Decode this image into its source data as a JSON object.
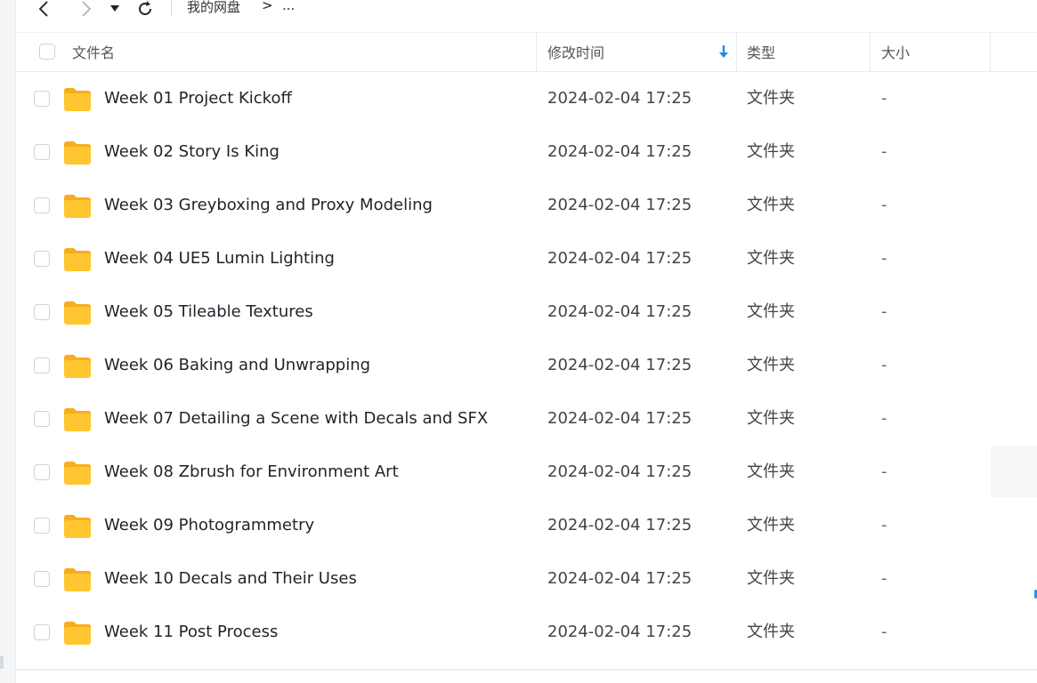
{
  "breadcrumb": {
    "root": "我的网盘",
    "separator": ">",
    "more": "..."
  },
  "columns": {
    "name": "文件名",
    "modified": "修改时间",
    "type": "类型",
    "size": "大小"
  },
  "colors": {
    "folder": "#FFC631",
    "folder_tab": "#F5AE1E",
    "sort_arrow": "#1E8CF0"
  },
  "icons": {
    "back": "chevron-left-icon",
    "forward": "chevron-right-icon",
    "history": "caret-down-icon",
    "refresh": "refresh-icon",
    "sort": "arrow-down-icon",
    "folder": "folder-icon"
  },
  "files": [
    {
      "name": "Week 01 Project Kickoff",
      "modified": "2024-02-04 17:25",
      "type": "文件夹",
      "size": "-"
    },
    {
      "name": "Week 02 Story Is King",
      "modified": "2024-02-04 17:25",
      "type": "文件夹",
      "size": "-"
    },
    {
      "name": "Week 03 Greyboxing and Proxy Modeling",
      "modified": "2024-02-04 17:25",
      "type": "文件夹",
      "size": "-"
    },
    {
      "name": "Week 04 UE5 Lumin Lighting",
      "modified": "2024-02-04 17:25",
      "type": "文件夹",
      "size": "-"
    },
    {
      "name": "Week 05 Tileable Textures",
      "modified": "2024-02-04 17:25",
      "type": "文件夹",
      "size": "-"
    },
    {
      "name": "Week 06 Baking and Unwrapping",
      "modified": "2024-02-04 17:25",
      "type": "文件夹",
      "size": "-"
    },
    {
      "name": "Week 07 Detailing a Scene with Decals and SFX",
      "modified": "2024-02-04 17:25",
      "type": "文件夹",
      "size": "-"
    },
    {
      "name": "Week 08 Zbrush for Environment Art",
      "modified": "2024-02-04 17:25",
      "type": "文件夹",
      "size": "-"
    },
    {
      "name": "Week 09 Photogrammetry",
      "modified": "2024-02-04 17:25",
      "type": "文件夹",
      "size": "-"
    },
    {
      "name": "Week 10 Decals and Their Uses",
      "modified": "2024-02-04 17:25",
      "type": "文件夹",
      "size": "-"
    },
    {
      "name": "Week 11 Post Process",
      "modified": "2024-02-04 17:25",
      "type": "文件夹",
      "size": "-"
    }
  ]
}
